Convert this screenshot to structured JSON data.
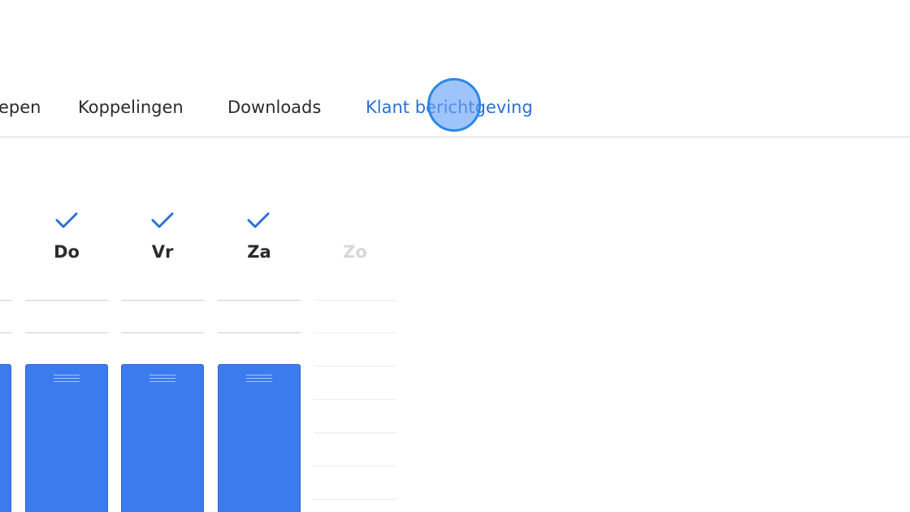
{
  "tabs": [
    {
      "label": "epen",
      "active": false
    },
    {
      "label": "Koppelingen",
      "active": false
    },
    {
      "label": "Downloads",
      "active": false
    },
    {
      "label": "Klant berichtgeving",
      "active": true
    }
  ],
  "days": [
    {
      "label": "Do",
      "checked": true,
      "enabled": true
    },
    {
      "label": "Vr",
      "checked": true,
      "enabled": true
    },
    {
      "label": "Za",
      "checked": true,
      "enabled": true
    },
    {
      "label": "Zo",
      "checked": false,
      "enabled": false
    }
  ],
  "colors": {
    "accent": "#2e6fd6",
    "block": "#3b7bee",
    "text": "#2b2b2b",
    "disabled": "#d7d7d7"
  },
  "icons": {
    "check": "check-icon",
    "grip": "drag-handle-icon"
  }
}
